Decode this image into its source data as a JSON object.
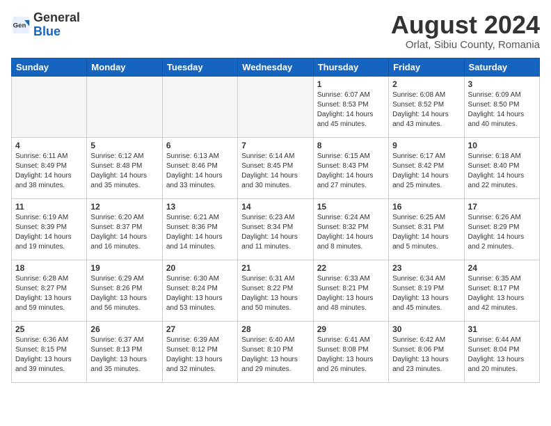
{
  "header": {
    "logo_general": "General",
    "logo_blue": "Blue",
    "month_title": "August 2024",
    "location": "Orlat, Sibiu County, Romania"
  },
  "weekdays": [
    "Sunday",
    "Monday",
    "Tuesday",
    "Wednesday",
    "Thursday",
    "Friday",
    "Saturday"
  ],
  "weeks": [
    [
      {
        "day": "",
        "info": ""
      },
      {
        "day": "",
        "info": ""
      },
      {
        "day": "",
        "info": ""
      },
      {
        "day": "",
        "info": ""
      },
      {
        "day": "1",
        "info": "Sunrise: 6:07 AM\nSunset: 8:53 PM\nDaylight: 14 hours\nand 45 minutes."
      },
      {
        "day": "2",
        "info": "Sunrise: 6:08 AM\nSunset: 8:52 PM\nDaylight: 14 hours\nand 43 minutes."
      },
      {
        "day": "3",
        "info": "Sunrise: 6:09 AM\nSunset: 8:50 PM\nDaylight: 14 hours\nand 40 minutes."
      }
    ],
    [
      {
        "day": "4",
        "info": "Sunrise: 6:11 AM\nSunset: 8:49 PM\nDaylight: 14 hours\nand 38 minutes."
      },
      {
        "day": "5",
        "info": "Sunrise: 6:12 AM\nSunset: 8:48 PM\nDaylight: 14 hours\nand 35 minutes."
      },
      {
        "day": "6",
        "info": "Sunrise: 6:13 AM\nSunset: 8:46 PM\nDaylight: 14 hours\nand 33 minutes."
      },
      {
        "day": "7",
        "info": "Sunrise: 6:14 AM\nSunset: 8:45 PM\nDaylight: 14 hours\nand 30 minutes."
      },
      {
        "day": "8",
        "info": "Sunrise: 6:15 AM\nSunset: 8:43 PM\nDaylight: 14 hours\nand 27 minutes."
      },
      {
        "day": "9",
        "info": "Sunrise: 6:17 AM\nSunset: 8:42 PM\nDaylight: 14 hours\nand 25 minutes."
      },
      {
        "day": "10",
        "info": "Sunrise: 6:18 AM\nSunset: 8:40 PM\nDaylight: 14 hours\nand 22 minutes."
      }
    ],
    [
      {
        "day": "11",
        "info": "Sunrise: 6:19 AM\nSunset: 8:39 PM\nDaylight: 14 hours\nand 19 minutes."
      },
      {
        "day": "12",
        "info": "Sunrise: 6:20 AM\nSunset: 8:37 PM\nDaylight: 14 hours\nand 16 minutes."
      },
      {
        "day": "13",
        "info": "Sunrise: 6:21 AM\nSunset: 8:36 PM\nDaylight: 14 hours\nand 14 minutes."
      },
      {
        "day": "14",
        "info": "Sunrise: 6:23 AM\nSunset: 8:34 PM\nDaylight: 14 hours\nand 11 minutes."
      },
      {
        "day": "15",
        "info": "Sunrise: 6:24 AM\nSunset: 8:32 PM\nDaylight: 14 hours\nand 8 minutes."
      },
      {
        "day": "16",
        "info": "Sunrise: 6:25 AM\nSunset: 8:31 PM\nDaylight: 14 hours\nand 5 minutes."
      },
      {
        "day": "17",
        "info": "Sunrise: 6:26 AM\nSunset: 8:29 PM\nDaylight: 14 hours\nand 2 minutes."
      }
    ],
    [
      {
        "day": "18",
        "info": "Sunrise: 6:28 AM\nSunset: 8:27 PM\nDaylight: 13 hours\nand 59 minutes."
      },
      {
        "day": "19",
        "info": "Sunrise: 6:29 AM\nSunset: 8:26 PM\nDaylight: 13 hours\nand 56 minutes."
      },
      {
        "day": "20",
        "info": "Sunrise: 6:30 AM\nSunset: 8:24 PM\nDaylight: 13 hours\nand 53 minutes."
      },
      {
        "day": "21",
        "info": "Sunrise: 6:31 AM\nSunset: 8:22 PM\nDaylight: 13 hours\nand 50 minutes."
      },
      {
        "day": "22",
        "info": "Sunrise: 6:33 AM\nSunset: 8:21 PM\nDaylight: 13 hours\nand 48 minutes."
      },
      {
        "day": "23",
        "info": "Sunrise: 6:34 AM\nSunset: 8:19 PM\nDaylight: 13 hours\nand 45 minutes."
      },
      {
        "day": "24",
        "info": "Sunrise: 6:35 AM\nSunset: 8:17 PM\nDaylight: 13 hours\nand 42 minutes."
      }
    ],
    [
      {
        "day": "25",
        "info": "Sunrise: 6:36 AM\nSunset: 8:15 PM\nDaylight: 13 hours\nand 39 minutes."
      },
      {
        "day": "26",
        "info": "Sunrise: 6:37 AM\nSunset: 8:13 PM\nDaylight: 13 hours\nand 35 minutes."
      },
      {
        "day": "27",
        "info": "Sunrise: 6:39 AM\nSunset: 8:12 PM\nDaylight: 13 hours\nand 32 minutes."
      },
      {
        "day": "28",
        "info": "Sunrise: 6:40 AM\nSunset: 8:10 PM\nDaylight: 13 hours\nand 29 minutes."
      },
      {
        "day": "29",
        "info": "Sunrise: 6:41 AM\nSunset: 8:08 PM\nDaylight: 13 hours\nand 26 minutes."
      },
      {
        "day": "30",
        "info": "Sunrise: 6:42 AM\nSunset: 8:06 PM\nDaylight: 13 hours\nand 23 minutes."
      },
      {
        "day": "31",
        "info": "Sunrise: 6:44 AM\nSunset: 8:04 PM\nDaylight: 13 hours\nand 20 minutes."
      }
    ]
  ]
}
